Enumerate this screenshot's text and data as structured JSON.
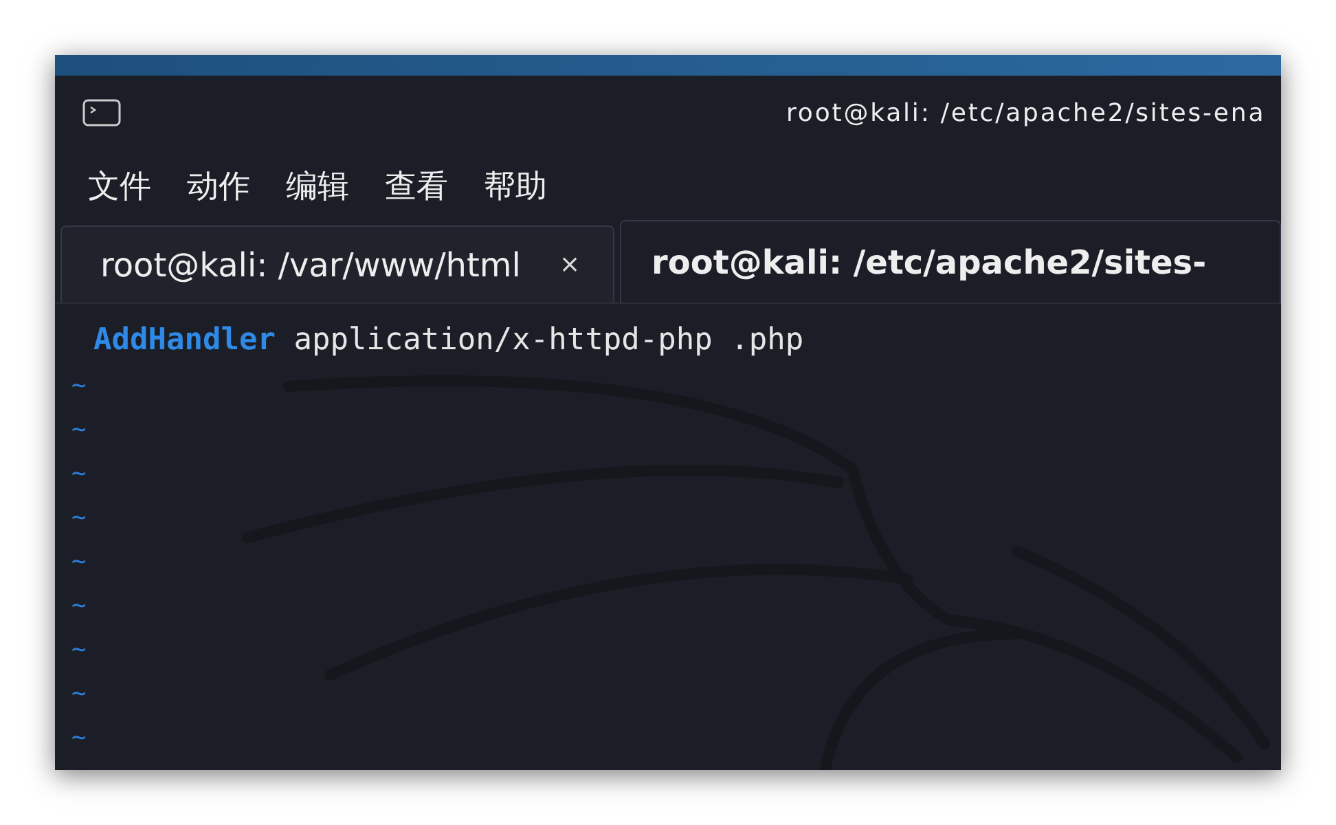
{
  "window": {
    "title": "root@kali: /etc/apache2/sites-ena"
  },
  "menu": [
    "文件",
    "动作",
    "编辑",
    "查看",
    "帮助"
  ],
  "tabs": [
    {
      "label": "root@kali: /var/www/html",
      "selected": false,
      "close": "×"
    },
    {
      "label": "root@kali: /etc/apache2/sites-",
      "selected": true
    }
  ],
  "editor": {
    "lines": [
      {
        "tokens": [
          {
            "text": "AddHandler",
            "kind": "keyword"
          },
          {
            "text": "application/x-httpd-php .php",
            "kind": "plain"
          }
        ]
      }
    ],
    "tildes": [
      "~",
      "~",
      "~",
      "~",
      "~",
      "~",
      "~",
      "~",
      "~"
    ]
  }
}
